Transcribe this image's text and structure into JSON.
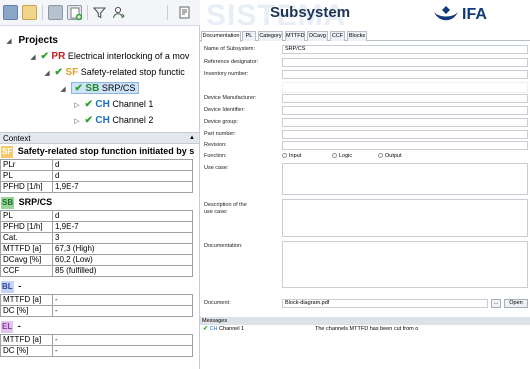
{
  "header": {
    "watermark": "SISTEMA",
    "title": "Subsystem",
    "logo_text": "IFA"
  },
  "tree": {
    "root_label": "Projects",
    "items": [
      {
        "tag": "PR",
        "label": "Electrical interlocking of a mov"
      },
      {
        "tag": "SF",
        "label": "Safety-related stop functic"
      },
      {
        "tag": "SB",
        "label": "SRP/CS"
      },
      {
        "tag": "CH",
        "label": "Channel 1"
      },
      {
        "tag": "CH",
        "label": "Channel 2"
      }
    ]
  },
  "context": {
    "title": "Context",
    "sf": {
      "tag": "SF",
      "label": "Safety-related stop function initiated by s",
      "rows": [
        {
          "k": "PLr",
          "v": "d"
        },
        {
          "k": "PL",
          "v": "d"
        },
        {
          "k": "PFHD [1/h]",
          "v": "1,9E-7"
        }
      ]
    },
    "sb": {
      "tag": "SB",
      "label": "SRP/CS",
      "rows": [
        {
          "k": "PL",
          "v": "d"
        },
        {
          "k": "PFHD [1/h]",
          "v": "1,9E-7"
        },
        {
          "k": "Cat.",
          "v": "3"
        },
        {
          "k": "MTTFD [a]",
          "v": "67,3 (High)"
        },
        {
          "k": "DCavg [%]",
          "v": "60,2 (Low)"
        },
        {
          "k": "CCF",
          "v": "85 (fulfilled)"
        }
      ]
    },
    "bl": {
      "tag": "BL",
      "label": "-",
      "rows": [
        {
          "k": "MTTFD [a]",
          "v": "-"
        },
        {
          "k": "DC [%]",
          "v": "-"
        }
      ]
    },
    "el": {
      "tag": "EL",
      "label": "-",
      "rows": [
        {
          "k": "MTTFD [a]",
          "v": "-"
        },
        {
          "k": "DC [%]",
          "v": "-"
        }
      ]
    }
  },
  "tabs": [
    "Documentation",
    "PL",
    "Category",
    "MTTFD",
    "DCavg",
    "CCF",
    "Blocks"
  ],
  "form": {
    "name_label": "Name of Subsystem:",
    "name_value": "SRP/CS",
    "ref_label": "Reference designator:",
    "inv_label": "Inventory number:",
    "manufacturer_label": "Device Manufacturer:",
    "identifier_label": "Device Identifier:",
    "group_label": "Device group:",
    "part_label": "Part number:",
    "revision_label": "Revision:",
    "function_label": "Function:",
    "function_options": [
      "Input",
      "Logic",
      "Output"
    ],
    "usecase_label": "Use case:",
    "desc_label_1": "Description of the",
    "desc_label_2": "use case:",
    "doc_label": "Documentation:",
    "document_label": "Document:",
    "document_value": "Block-diagram.pdf",
    "browse_label": "...",
    "open_label": "Open"
  },
  "messages": {
    "title": "Messages",
    "row_tag": "CH",
    "row_source": "Channel 1",
    "row_text": "The channels MTTFD has been cut from o"
  },
  "colors": {
    "check": "#2aa52a",
    "pr": "#c81e1e",
    "sf": "#e0a030",
    "sb": "#1f8a2a",
    "ch": "#1d6fc9",
    "logo": "#123a7a"
  }
}
